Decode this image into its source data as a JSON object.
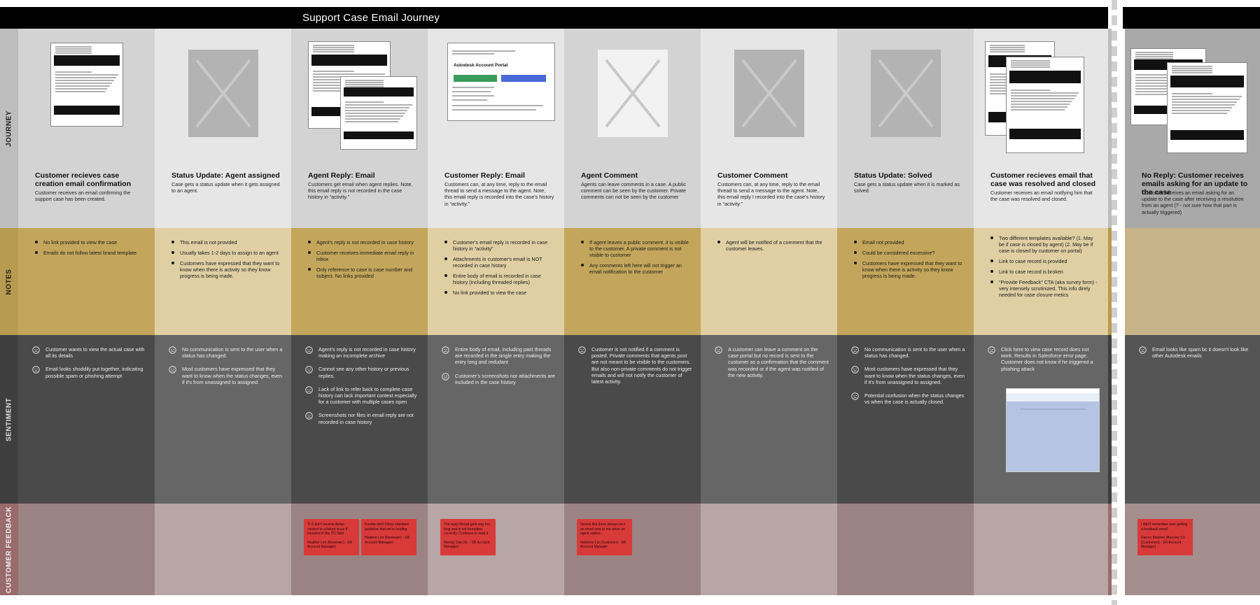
{
  "title": "Support Case Email Journey",
  "lanes": {
    "journey": "JOURNEY",
    "notes": "NOTES",
    "sentiment": "SENTIMENT",
    "feedback": "CUSTOMER FEEDBACK"
  },
  "columns": [
    {
      "title": "Customer recieves case creation email confirmation",
      "desc": "Customer receives an email confirming the support case has been created.",
      "notes": [
        "No link provided to view the case",
        "Emails do not follow latest brand template"
      ],
      "sentiment": [
        "Customer wants to view the actual case with all its details",
        "Email looks shoddily put together, indicating possible spam or phishing attempt"
      ],
      "feedback": []
    },
    {
      "title": "Status Update: Agent assigned",
      "desc": "Case gets a status update when it gets assigned to an agent.",
      "notes": [
        "This email is not provided",
        "Usually takes 1-2 days to assign to an agent",
        "Customers have expressed that they want to know when there is activity so they know progress is being made."
      ],
      "sentiment": [
        "No communication is sent to the user when a status has changed.",
        "Most customers have expressed that they want to know when the status changes, even if it's from unassigned to assigned."
      ],
      "feedback": []
    },
    {
      "title": "Agent Reply: Email",
      "desc": "Customers get email when agent replies. Note, this email reply is not recorded in the case history in “activity.”",
      "notes": [
        "Agent's reply is not recorded in case history",
        "Customer receives immediate email reply in inbox",
        "Only reference to case is case number and subject. No links provided"
      ],
      "sentiment": [
        "Agent's reply is not recorded in case history making an incomplete archive",
        "Cannot see any other history or previous replies.",
        "Lack of link to refer back to complete case history can lack important context especially for a customer with multiple cases open",
        "Screenshots nor files in email reply are not recorded in case history"
      ],
      "feedback": [
        {
          "text": "TLS don't receive Aidan context to a linked issue if included in the ITC field",
          "who": "Heather Lim (Reviewer) - SR Account Manager)"
        },
        {
          "text": "Kundia don't follow standard guideline that we're lending",
          "who": "Heather Lim (Reviewer) - SR Account Manager)"
        }
      ]
    },
    {
      "title": "Customer Reply: Email",
      "desc": "Customers can, at any time, reply to the email thread to send a message to the agent. Note, this email reply is recorded into the case's history in “activity.”",
      "notes": [
        "Customer's email reply is recorded in case history in “activity”",
        "Attachments in customer's email is NOT recorded in case history",
        "Entire body of email is recorded in case history (including threaded replies)",
        "No link provided to view the case"
      ],
      "sentiment": [
        "Entire body of email, including past threads are recorded in the single entry making the entry long and redudant",
        "Customer's screenshots nor attachments are included in the case history"
      ],
      "feedback": [
        {
          "text": "The reply thread gets way too long and is not formatted correctly. Confuses to read it.",
          "who": "Wendy Gist (Sr. - SR Account Manager)"
        }
      ]
    },
    {
      "title": "Agent Comment",
      "desc": "Agents can leave comments in a case. A public comment can be seen by the customer. Private comments can not be seen by the customer",
      "notes": [
        "If agent leaves a public comment, it is visible to the customer. A private comment is not visible to customer",
        "Any comments left here will not trigger an email notification to the customer"
      ],
      "sentiment": [
        "Customer is not notified if a comment is posted. Private comments that agents post are not meant to be visible to the customers. But also non-private comments do not trigger emails and will not notify the customer of latest activity."
      ],
      "feedback": [
        {
          "text": "Seems like there always isn't an email sent to me when an agent replies.",
          "who": "Nokomis Lia (Customer) - SR Account Manager"
        }
      ]
    },
    {
      "title": "Customer Comment",
      "desc": "Customers can, at any time, reply to the email thread to send a message to the agent. Note, this email reply I recorded into the case's history in “activity.”",
      "notes": [
        "Agent will be notified of a comment that the customer leaves."
      ],
      "sentiment": [
        "A customer can leave a comment on the case portal but no record is sent to the customer as a confirmation that the comment was recorded or if the agent was notified of the new activity."
      ],
      "feedback": []
    },
    {
      "title": "Status Update: Solved",
      "desc": "Case gets a status update when it is marked as solved",
      "notes": [
        "Email not provided",
        "Could be considered excessive?",
        "Customers have expressed that they want to know when there is activity so they know progress is being made."
      ],
      "sentiment": [
        "No communication is sent to the user when a status has changed.",
        "Most customers have expressed that they want to know when the status changes, even if it's from unassigned to assigned.",
        "Potential confusion when the status changes vs when the case is actually closed."
      ],
      "feedback": []
    },
    {
      "title": "Customer recieves email that case was resolved and closed",
      "desc": "Customer receives an email notifying him that the case was resolved and closed.",
      "notes": [
        "Two different templates available? (1. May be if case is closed by agent) (2. May be if case is closed by customer on portal)",
        "Link to case record is provided",
        "Link to case record is broken",
        "“Provide Feedback” CTA (aka survey form) - very intensely scrutinized. This info direly needed for case closure metics"
      ],
      "sentiment": [
        "Click here to view case record does not work. Results in Salesforce error page. Customer does not know if he triggered a phishing attack"
      ],
      "feedback": []
    },
    {
      "title": "No Reply: Customer receives emails asking for an update to the case",
      "desc": "Customer receives an email asking for an update to the case after receiving a resolution from an agent (? - not sure how that part is actually triggered)",
      "notes": [],
      "sentiment": [
        "Email looks like spam bc it doesn't look like other Autodesk emails"
      ],
      "feedback": [
        {
          "text": "I didn't remember ever getting a feedback email",
          "who": "Darren Moellen (Beesley Co (Customer)) - SR Account Manager)"
        }
      ]
    }
  ],
  "thumb_texts": {
    "brand": "AUTODESK",
    "portal": "Autodesk Account Portal"
  },
  "colors": {
    "journey": [
      "#d3d3d3",
      "#e6e6e6"
    ],
    "notes": [
      "#c3a65b",
      "#dfcfa3"
    ],
    "sentiment": [
      "#4a4a4a",
      "#666666"
    ],
    "feedback": [
      "#9c8383",
      "#b8a5a5"
    ],
    "sticky": "#d83a3a"
  }
}
